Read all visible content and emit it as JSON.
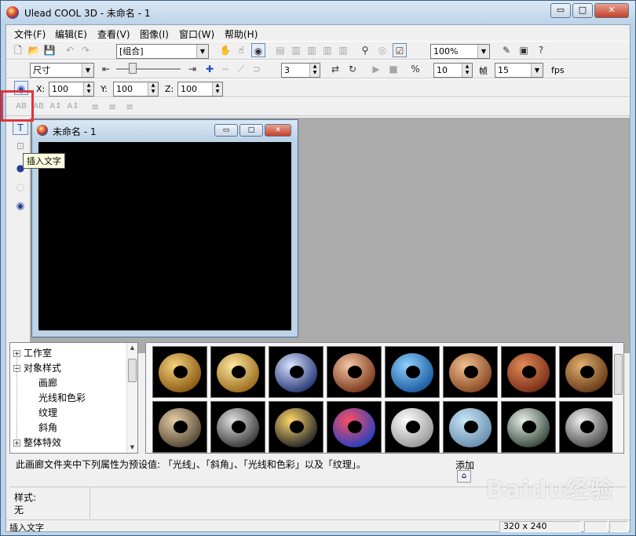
{
  "window": {
    "title": "Ulead COOL 3D - 未命名 - 1",
    "buttons": {
      "minimize": "▭",
      "maximize": "□",
      "close": "✕"
    }
  },
  "menu": [
    "文件(F)",
    "编辑(E)",
    "查看(V)",
    "图像(I)",
    "窗口(W)",
    "帮助(H)"
  ],
  "toolbar": {
    "object_combo": "[组合]",
    "zoom_combo": "100%",
    "property_combo": "尺寸",
    "frame_count": "3",
    "percent_value": "10",
    "frame_label": "帧",
    "fps_value": "15",
    "fps_label": "fps",
    "x_label": "X:",
    "x_value": "100",
    "y_label": "Y:",
    "y_value": "100",
    "z_label": "Z:",
    "z_value": "100"
  },
  "tooltip": "插入文字",
  "doc_window": {
    "title": "未命名 - 1"
  },
  "tree": {
    "items": [
      "工作室",
      "对象样式",
      "画廊",
      "光线和色彩",
      "纹理",
      "斜角",
      "整体特效"
    ]
  },
  "gallery": {
    "thumbnails": [
      {
        "name": "gold-torus",
        "colors": [
          "#f2d27a",
          "#8c5a14"
        ]
      },
      {
        "name": "gold-ring",
        "colors": [
          "#ffe7a0",
          "#9b6d1d"
        ]
      },
      {
        "name": "silver-blue-torus",
        "colors": [
          "#d9e3ff",
          "#2b3a78"
        ]
      },
      {
        "name": "copper-torus",
        "colors": [
          "#f7c6a6",
          "#7a3a1d"
        ]
      },
      {
        "name": "blue-marble-torus",
        "colors": [
          "#8fd0ff",
          "#1b5da0"
        ]
      },
      {
        "name": "wood-ring-torus",
        "colors": [
          "#f0c090",
          "#8a4a24"
        ]
      },
      {
        "name": "terracotta-torus",
        "colors": [
          "#e28a5a",
          "#7a3018"
        ]
      },
      {
        "name": "leather-torus",
        "colors": [
          "#e2b070",
          "#6a3c18"
        ]
      },
      {
        "name": "stone-torus",
        "colors": [
          "#e6cfa6",
          "#5a4a38"
        ]
      },
      {
        "name": "mesh-torus",
        "colors": [
          "#e0e0e0",
          "#3c3c3c"
        ]
      },
      {
        "name": "dotted-torus",
        "colors": [
          "#ffd86a",
          "#2a2a2a"
        ]
      },
      {
        "name": "stained-glass-torus",
        "colors": [
          "#ff5060",
          "#2a40c0"
        ]
      },
      {
        "name": "white-torus",
        "colors": [
          "#ffffff",
          "#9a9a9a"
        ]
      },
      {
        "name": "water-torus",
        "colors": [
          "#c8e6f6",
          "#6a90b0"
        ]
      },
      {
        "name": "chrome-torus",
        "colors": [
          "#e8f0e8",
          "#3c4c40"
        ]
      },
      {
        "name": "steel-torus",
        "colors": [
          "#f0f0f0",
          "#505050"
        ]
      }
    ]
  },
  "description": "此画廊文件夹中下列属性为预设值: 「光线」、「斜角」、「光线和色彩」以及「纹理」。",
  "add_label": "添加",
  "style": {
    "label": "样式:",
    "value": "无"
  },
  "statusbar": {
    "text": "插入文字",
    "size": "320 x 240"
  },
  "watermark": "Baidu经验",
  "colors": {
    "highlight": "#e3343b",
    "canvas": "#000000",
    "workspace": "#ababab"
  }
}
